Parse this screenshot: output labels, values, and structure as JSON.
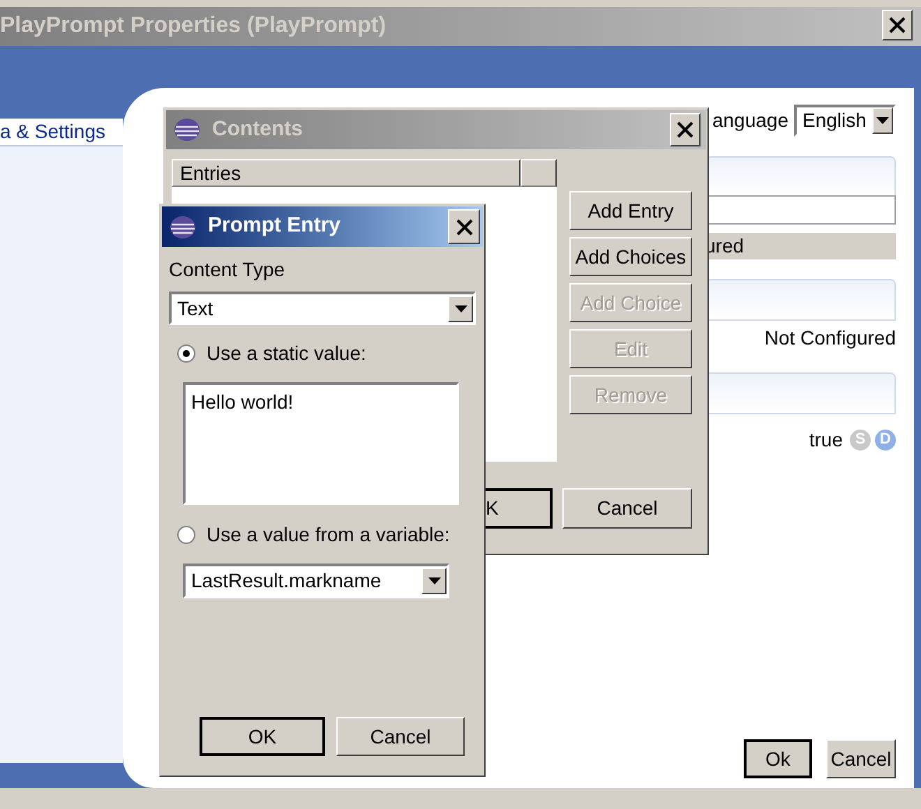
{
  "main_window": {
    "title": "PlayPrompt Properties (PlayPrompt)",
    "active": false,
    "sidebar": {
      "items": [
        {
          "label": "a & Settings",
          "selected": true
        }
      ]
    },
    "language": {
      "label": "anguage",
      "value": "English"
    },
    "rows": [
      {
        "kind": "header"
      },
      {
        "kind": "input"
      },
      {
        "kind": "band",
        "text": "ured"
      },
      {
        "kind": "header"
      },
      {
        "kind": "value",
        "text": "Not Configured"
      },
      {
        "kind": "header"
      },
      {
        "kind": "flags",
        "text": "true",
        "flags": [
          {
            "label": "S",
            "color": "#c8c8c8"
          },
          {
            "label": "D",
            "color": "#8fb0e6"
          }
        ]
      }
    ],
    "buttons": [
      {
        "label": "Ok",
        "default": true
      },
      {
        "label": "Cancel",
        "default": false
      }
    ]
  },
  "contents_dialog": {
    "title": "Contents",
    "active": false,
    "columns": [
      "Entries"
    ],
    "side_buttons": [
      {
        "label": "Add Entry",
        "disabled": false
      },
      {
        "label": "Add Choices",
        "disabled": false
      },
      {
        "label": "Add Choice",
        "disabled": true
      },
      {
        "label": "Edit",
        "disabled": true
      },
      {
        "label": "Remove",
        "disabled": true
      }
    ],
    "buttons": [
      {
        "label": "K",
        "default": true
      },
      {
        "label": "Cancel",
        "default": false
      }
    ]
  },
  "prompt_entry_dialog": {
    "title": "Prompt Entry",
    "active": true,
    "content_type": {
      "label": "Content Type",
      "value": "Text"
    },
    "options": [
      {
        "label": "Use a static value:",
        "selected": true
      },
      {
        "label": "Use a value from a variable:",
        "selected": false
      }
    ],
    "static_value": "Hello world!",
    "variable": "LastResult.markname",
    "buttons": [
      {
        "label": "OK",
        "default": true
      },
      {
        "label": "Cancel",
        "default": false
      }
    ]
  }
}
